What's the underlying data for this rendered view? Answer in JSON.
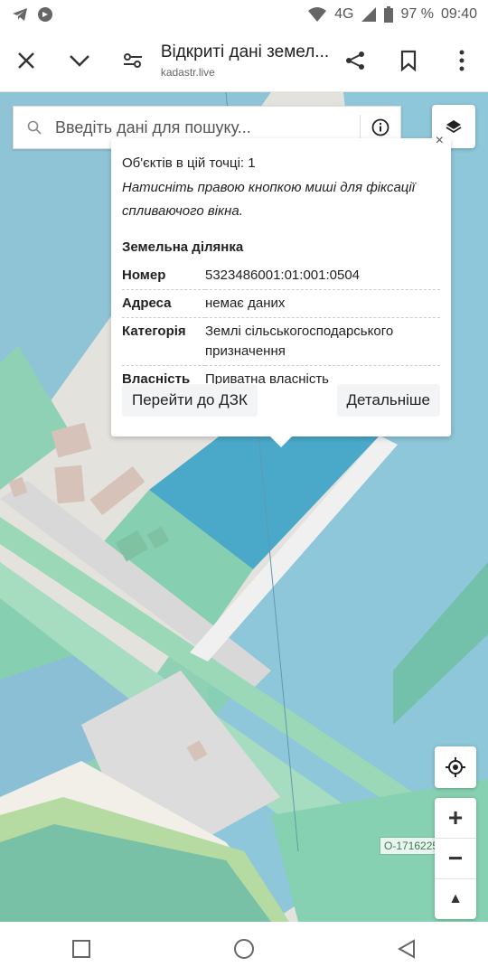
{
  "status_bar": {
    "network": "4G",
    "battery": "97 %",
    "time": "09:40"
  },
  "toolbar": {
    "title": "Відкриті дані земел...",
    "url": "kadastr.live"
  },
  "search": {
    "placeholder": "Введіть дані для пошуку..."
  },
  "popup": {
    "count_text": "Об'єктів в цій точці: 1",
    "hint_text": "Натисніть правою кнопкою миші для фіксації спливаючого вікна.",
    "section_title": "Земельна ділянка",
    "rows": [
      {
        "key": "Номер",
        "value": "5323486001:01:001:0504"
      },
      {
        "key": "Адреса",
        "value": "немає даних"
      },
      {
        "key": "Категорія",
        "value": "Землі сільськогосподарського призначення"
      },
      {
        "key": "Власність",
        "value": "Приватна власність"
      }
    ],
    "button_dzk": "Перейти до ДЗК",
    "button_details": "Детальніше"
  },
  "zoom": {
    "plus": "+",
    "minus": "−",
    "north": "▲"
  },
  "map_label": "O-1716225",
  "colors": {
    "water": "#8ec7d9",
    "parcel_selected": "#4aa8c8",
    "green": "#86cfb0",
    "road": "#e6e6e6"
  }
}
